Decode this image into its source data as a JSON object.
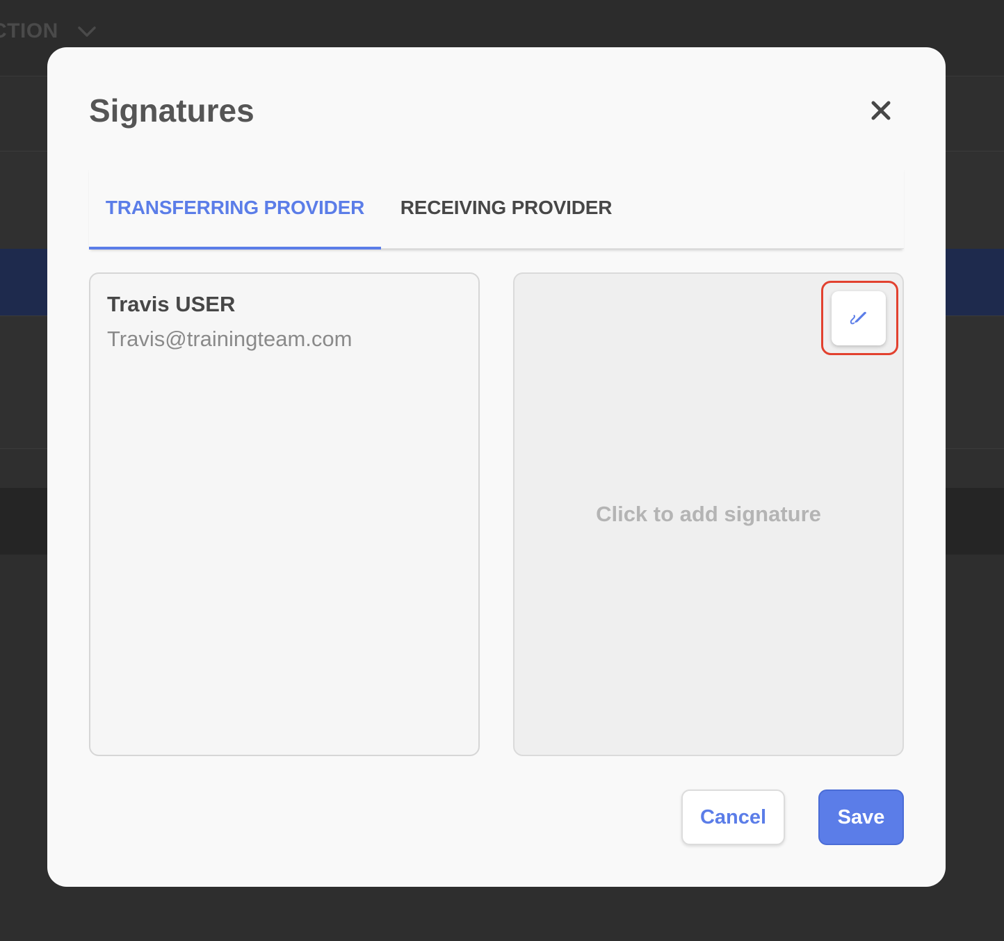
{
  "background": {
    "topbar_label": "CTION"
  },
  "modal": {
    "title": "Signatures"
  },
  "tabs": [
    {
      "label": "TRANSFERRING PROVIDER",
      "active": true
    },
    {
      "label": "RECEIVING PROVIDER",
      "active": false
    }
  ],
  "provider": {
    "name": "Travis USER",
    "email": "Travis@trainingteam.com"
  },
  "signature": {
    "placeholder": "Click to add signature",
    "edit_icon": "pencil-icon"
  },
  "footer": {
    "cancel_label": "Cancel",
    "save_label": "Save"
  },
  "colors": {
    "accent": "#5b7de8",
    "highlight": "#e2412f",
    "overlay": "#2e2e2e",
    "modal_bg": "#f9f9f9"
  }
}
